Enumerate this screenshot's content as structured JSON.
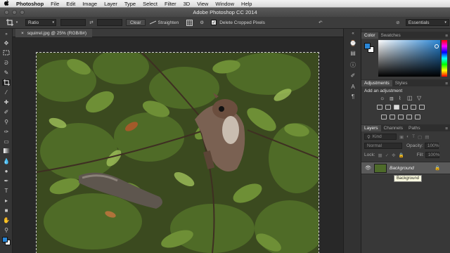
{
  "menubar": {
    "apple": "",
    "app_name": "Photoshop",
    "items": [
      "File",
      "Edit",
      "Image",
      "Layer",
      "Type",
      "Select",
      "Filter",
      "3D",
      "View",
      "Window",
      "Help"
    ]
  },
  "window": {
    "title": "Adobe Photoshop CC 2014"
  },
  "options_bar": {
    "ratio_label": "Ratio",
    "clear_label": "Clear",
    "straighten_label": "Straighten",
    "delete_cropped_label": "Delete Cropped Pixels",
    "delete_cropped_checked": true,
    "workspace_label": "Essentials"
  },
  "document": {
    "tab_label": "squirrel.jpg @ 25% (RGB/8#)"
  },
  "color_panel": {
    "tabs": [
      "Color",
      "Swatches"
    ],
    "foreground": "#2a86d6",
    "background": "#ffffff"
  },
  "adjustments_panel": {
    "tabs": [
      "Adjustments",
      "Styles"
    ],
    "heading": "Add an adjustment"
  },
  "layers_panel": {
    "tabs": [
      "Layers",
      "Channels",
      "Paths"
    ],
    "kind_label": "Kind",
    "blend_mode": "Normal",
    "opacity_label": "Opacity:",
    "opacity_value": "100%",
    "lock_label": "Lock:",
    "fill_label": "Fill:",
    "fill_value": "100%",
    "layer_name": "Background",
    "tooltip": "Background"
  },
  "colors": {
    "accent": "#2a86d6",
    "panel": "#383838",
    "canvas_bg": "#282828"
  }
}
